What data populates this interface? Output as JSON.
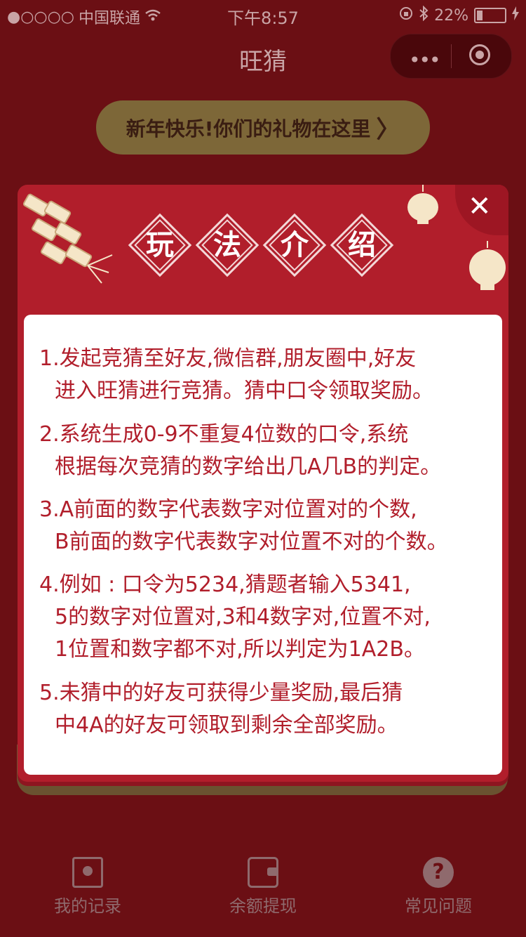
{
  "status_bar": {
    "signal": "●○○○○",
    "carrier": "中国联通",
    "time": "下午8:57",
    "battery": "22%"
  },
  "nav": {
    "title": "旺猜",
    "more_icon": "•••"
  },
  "gift_banner": {
    "label": "新年快乐!你们的礼物在这里",
    "chevron": "〉"
  },
  "modal": {
    "title_chars": [
      "玩",
      "法",
      "介",
      "绍"
    ],
    "close_symbol": "✕",
    "rules": [
      {
        "line1": "1.发起竞猜至好友,微信群,朋友圈中,好友",
        "line2": "进入旺猜进行竞猜。猜中口令领取奖励。"
      },
      {
        "line1": "2.系统生成0-9不重复4位数的口令,系统",
        "line2": "根据每次竞猜的数字给出几A几B的判定。"
      },
      {
        "line1": "3.A前面的数字代表数字对位置对的个数,",
        "line2": "B前面的数字代表数字对位置不对的个数。"
      },
      {
        "line1": "4.例如 : 口令为5234,猜题者输入5341,",
        "line2": "5的数字对位置对,3和4数字对,位置不对,",
        "line3": "1位置和数字都不对,所以判定为1A2B。"
      },
      {
        "line1": "5.未猜中的好友可获得少量奖励,最后猜",
        "line2": "中4A的好友可领取到剩余全部奖励。"
      }
    ]
  },
  "tabbar": {
    "tabs": [
      {
        "label": "我的记录",
        "icon": "record-book-icon"
      },
      {
        "label": "余额提现",
        "icon": "wallet-icon"
      },
      {
        "label": "常见问题",
        "icon": "help-icon",
        "glyph": "?"
      }
    ]
  },
  "colors": {
    "page_bg": "#6b0f14",
    "modal_red": "#b11e2b",
    "gold": "#7d6738"
  }
}
